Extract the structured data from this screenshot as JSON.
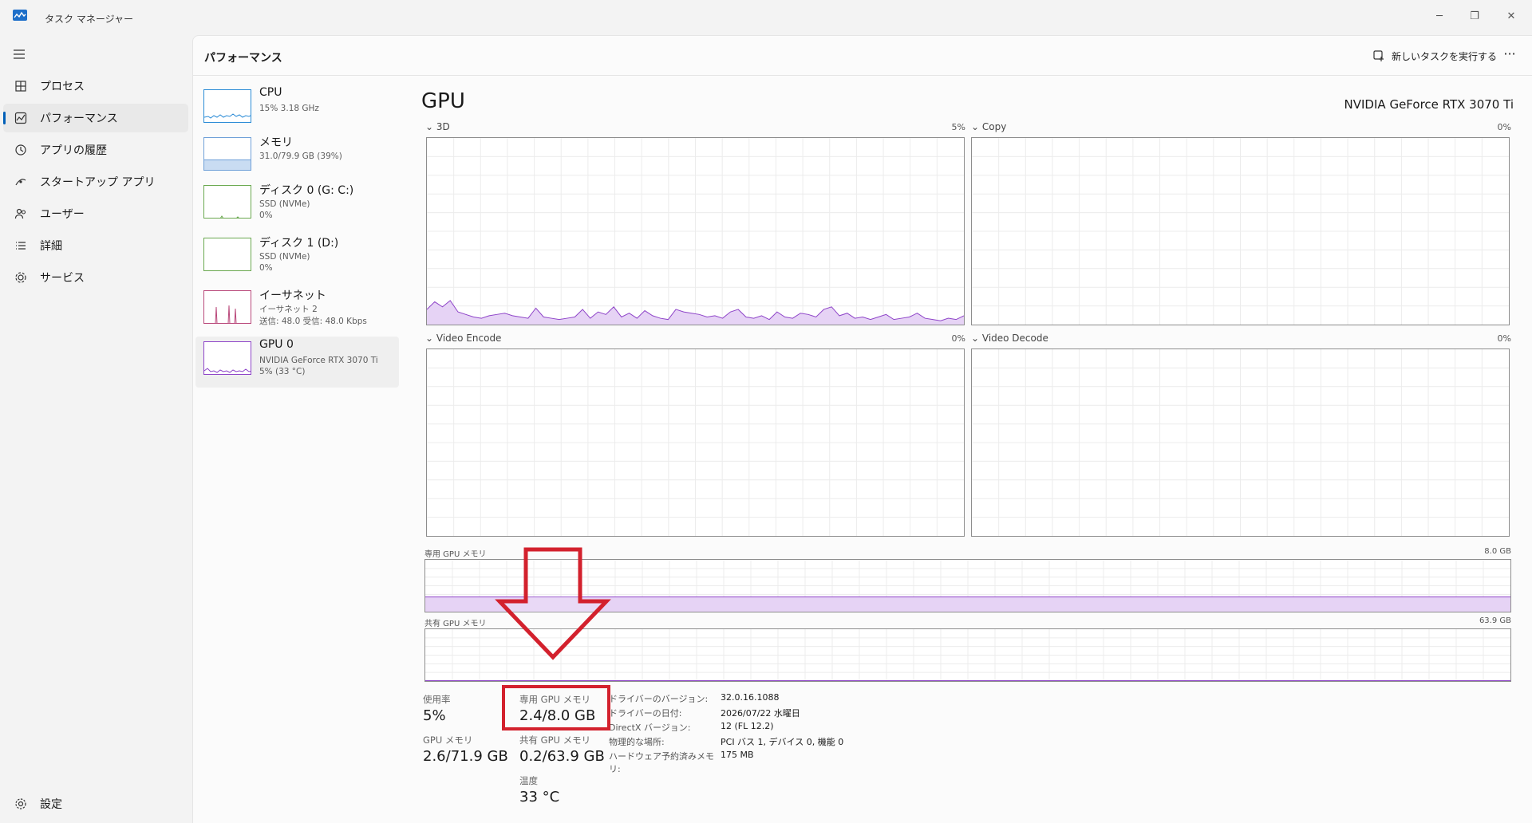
{
  "app": {
    "title": "タスク マネージャー"
  },
  "nav": {
    "items": [
      {
        "icon": "processes-icon",
        "label": "プロセス"
      },
      {
        "icon": "performance-icon",
        "label": "パフォーマンス",
        "active": true
      },
      {
        "icon": "history-icon",
        "label": "アプリの履歴"
      },
      {
        "icon": "startup-icon",
        "label": "スタートアップ アプリ"
      },
      {
        "icon": "users-icon",
        "label": "ユーザー"
      },
      {
        "icon": "details-icon",
        "label": "詳細"
      },
      {
        "icon": "services-icon",
        "label": "サービス"
      }
    ],
    "settings_label": "設定"
  },
  "header": {
    "title": "パフォーマンス",
    "new_task_label": "新しいタスクを実行する",
    "more_label": "···"
  },
  "resources": [
    {
      "name": "CPU",
      "sub1": "15%  3.18 GHz",
      "sub2": ""
    },
    {
      "name": "メモリ",
      "sub1": "31.0/79.9 GB (39%)",
      "sub2": ""
    },
    {
      "name": "ディスク 0 (G: C:)",
      "sub1": "SSD (NVMe)",
      "sub2": "0%"
    },
    {
      "name": "ディスク 1 (D:)",
      "sub1": "SSD (NVMe)",
      "sub2": "0%"
    },
    {
      "name": "イーサネット",
      "sub1": "イーサネット 2",
      "sub2": "送信: 48.0  受信: 48.0 Kbps"
    },
    {
      "name": "GPU 0",
      "sub1": "NVIDIA GeForce RTX 3070 Ti",
      "sub2": "5%  (33 °C)"
    }
  ],
  "gpu": {
    "title": "GPU",
    "model": "NVIDIA GeForce RTX 3070 Ti",
    "engines": [
      {
        "name": "3D",
        "pct": "5%"
      },
      {
        "name": "Copy",
        "pct": "0%"
      },
      {
        "name": "Video Encode",
        "pct": "0%"
      },
      {
        "name": "Video Decode",
        "pct": "0%"
      }
    ],
    "dedicated": {
      "label": "専用 GPU メモリ",
      "max": "8.0 GB",
      "usage_fraction": 0.3
    },
    "shared": {
      "label": "共有 GPU メモリ",
      "max": "63.9 GB",
      "usage_fraction": 0.003
    },
    "stats": {
      "usage_label": "使用率",
      "usage": "5%",
      "dedicated_label": "専用 GPU メモリ",
      "dedicated": "2.4/8.0 GB",
      "gpu_mem_label": "GPU メモリ",
      "gpu_mem": "2.6/71.9 GB",
      "shared_label": "共有 GPU メモリ",
      "shared": "0.2/63.9 GB",
      "temp_label": "温度",
      "temp": "33 °C"
    },
    "info": [
      {
        "k": "ドライバーのバージョン:",
        "v": "32.0.16.1088"
      },
      {
        "k": "ドライバーの日付:",
        "v": "2026/07/22 水曜日"
      },
      {
        "k": "DirectX バージョン:",
        "v": "12 (FL 12.2)"
      },
      {
        "k": "物理的な場所:",
        "v": "PCI バス 1, デバイス 0, 機能 0"
      },
      {
        "k": "ハードウェア予約済みメモリ:",
        "v": "175 MB"
      }
    ]
  },
  "colors": {
    "accent": "#005fb8",
    "gpu_line": "#8e44c8",
    "gpu_fill": "#e6d3f5",
    "annotation": "#d3212d"
  }
}
